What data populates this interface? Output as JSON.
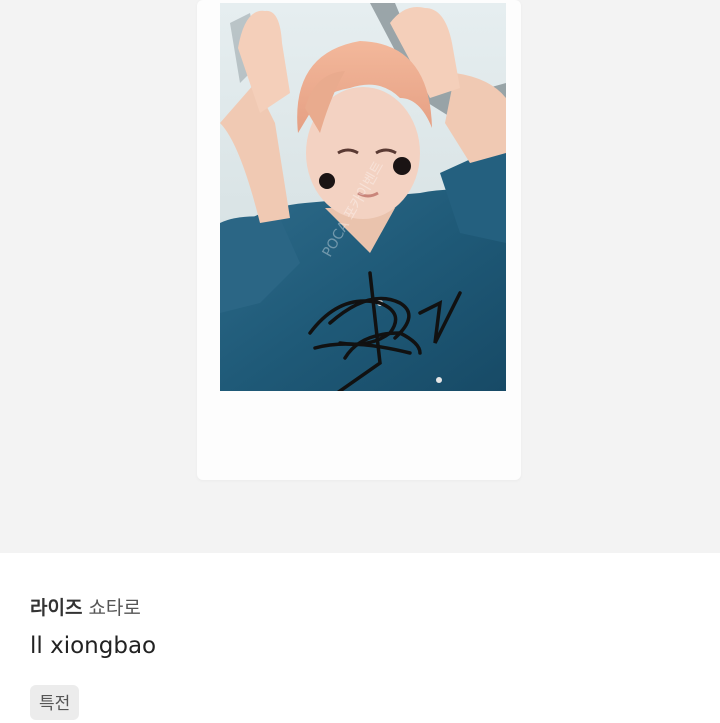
{
  "product": {
    "photo_label": "POCA 포카이벤트",
    "group": "라이즈",
    "member": "쇼타로",
    "title": "ll xiongbao",
    "tags": [
      "특전"
    ]
  }
}
